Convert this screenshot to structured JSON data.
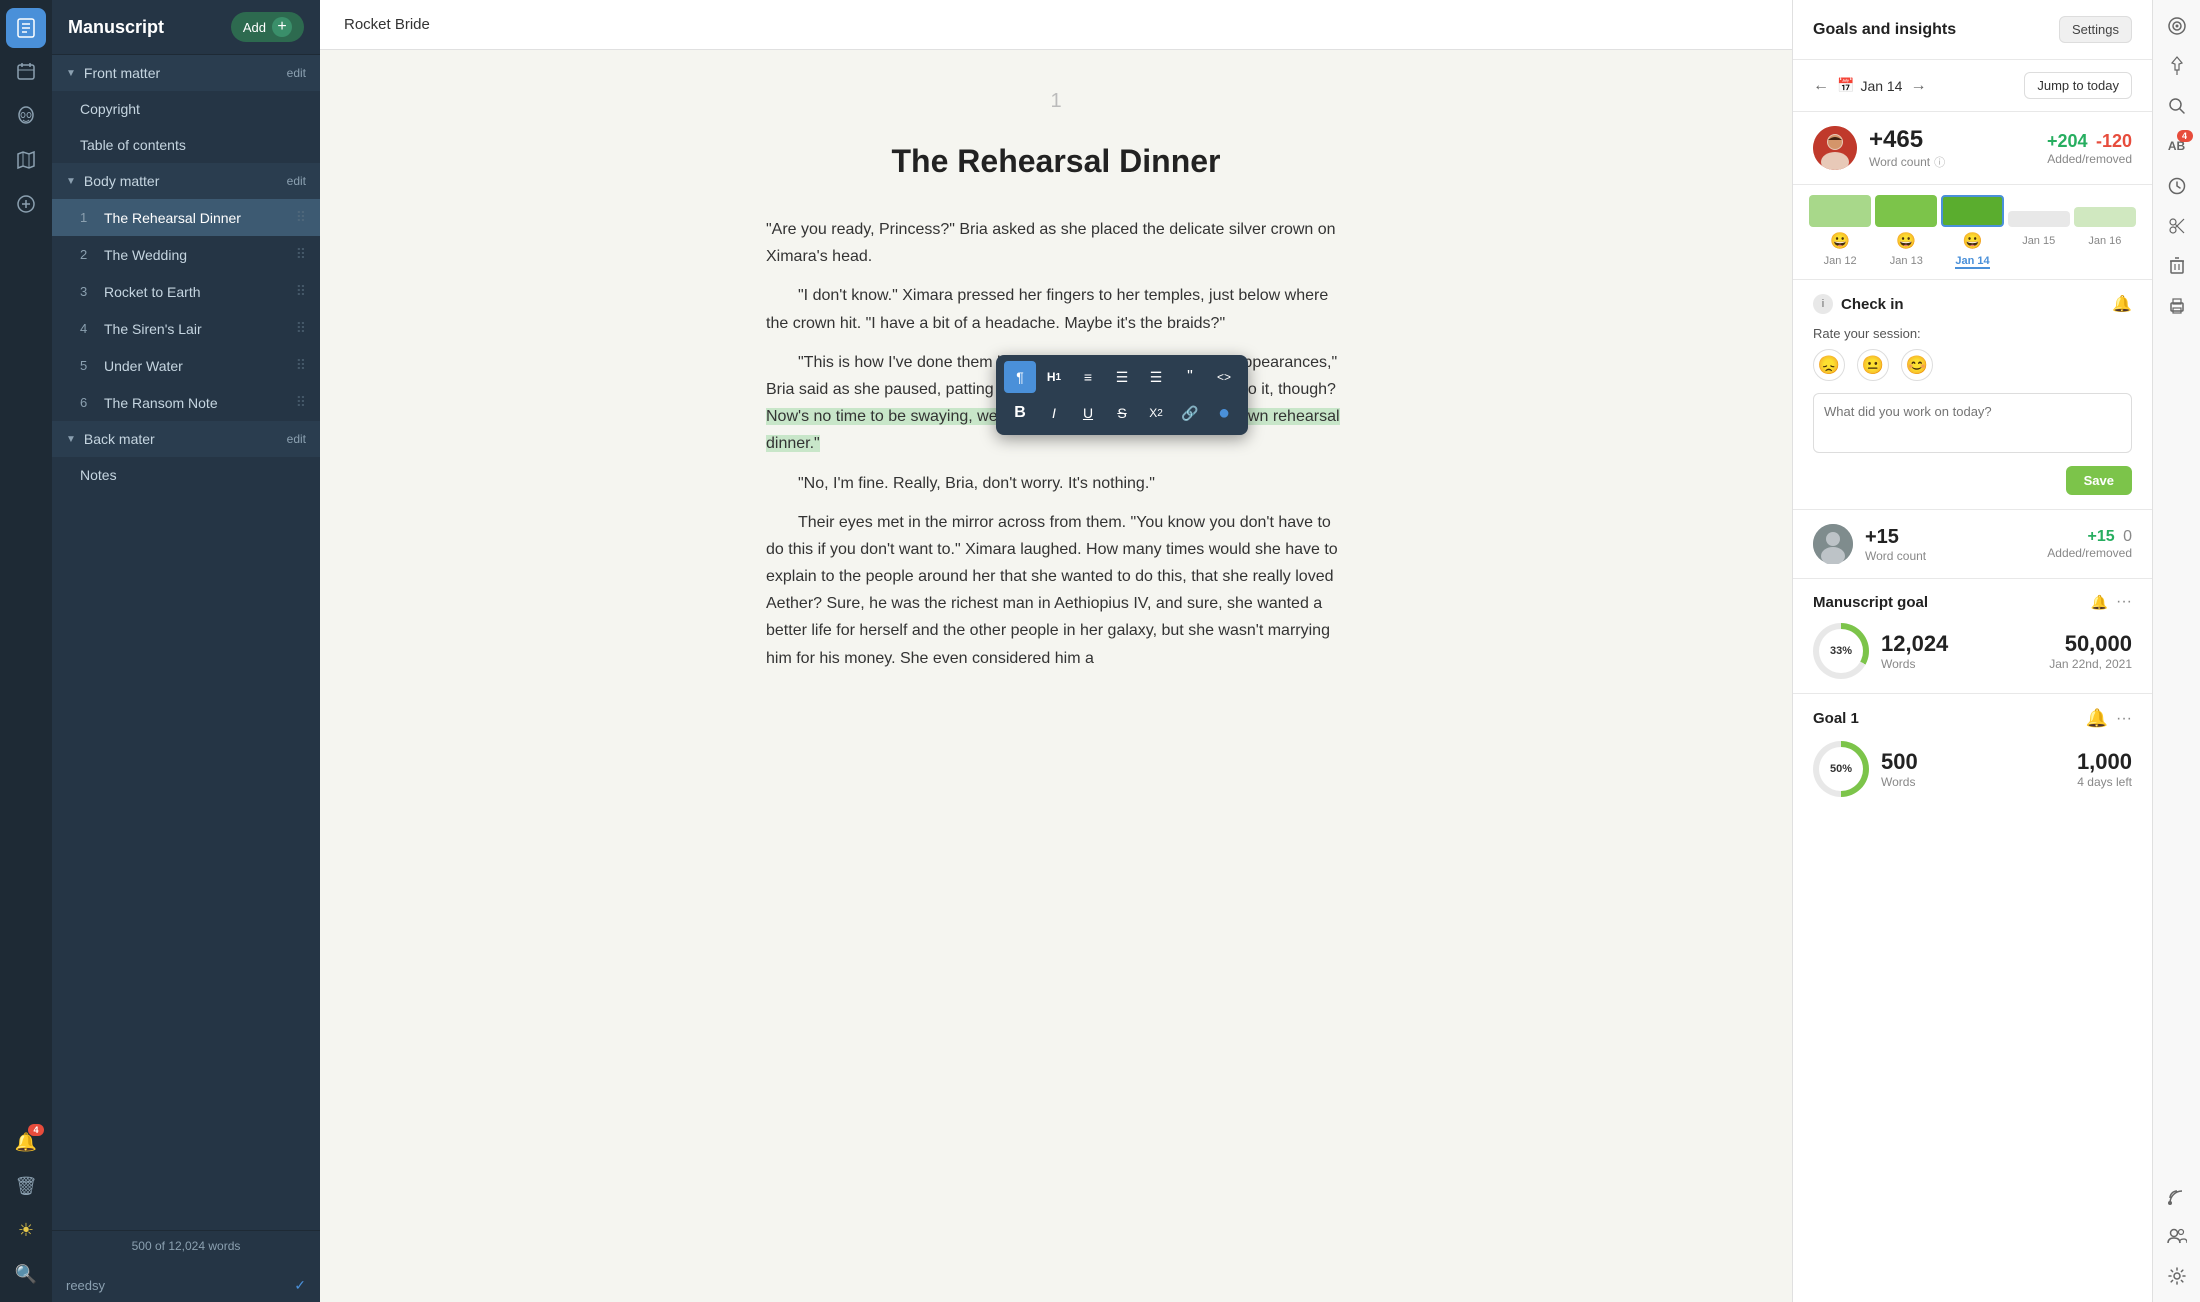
{
  "app": {
    "title": "Manuscript",
    "add_label": "Add",
    "book_title": "Rocket Bride"
  },
  "sidebar": {
    "front_matter": {
      "label": "Front matter",
      "edit": "edit",
      "items": [
        {
          "id": "copyright",
          "label": "Copyright",
          "num": ""
        },
        {
          "id": "toc",
          "label": "Table of contents",
          "num": ""
        }
      ]
    },
    "body_matter": {
      "label": "Body matter",
      "edit": "edit",
      "items": [
        {
          "id": "ch1",
          "num": "1",
          "label": "The Rehearsal Dinner"
        },
        {
          "id": "ch2",
          "num": "2",
          "label": "The Wedding"
        },
        {
          "id": "ch3",
          "num": "3",
          "label": "Rocket to Earth"
        },
        {
          "id": "ch4",
          "num": "4",
          "label": "The Siren's Lair"
        },
        {
          "id": "ch5",
          "num": "5",
          "label": "Under Water"
        },
        {
          "id": "ch6",
          "num": "6",
          "label": "The Ransom Note"
        }
      ]
    },
    "back_matter": {
      "label": "Back mater",
      "edit": "edit",
      "items": [
        {
          "id": "notes",
          "label": "Notes",
          "num": ""
        }
      ]
    },
    "word_count": "500 of 12,024 words",
    "branding": "reedsy"
  },
  "editor": {
    "chapter_num": "1",
    "chapter_title": "The Rehearsal Dinner",
    "content": [
      {
        "type": "quote",
        "text": "“Are you ready, Princess?” Bria asked as she placed the delicate silver crown on Ximara’s head."
      },
      {
        "type": "indent",
        "text": "“I don’t know.” Ximara pressed her fingers to her temples, just below where the crown hit. “I have a bit of a headache. Maybe it’s the braids?”"
      },
      {
        "type": "indent",
        "text": "“This is how I’ve done them been for every one of your public appearances,” Bria said as she paused, patting Ximara on the shoulder. “You can do it, though? Now’s no time to be swaying, we wouldn’t want to pass out at your own rehearsal dinner.”",
        "highlight_start": true
      },
      {
        "type": "indent",
        "text": "“No, I’m fine. Really, Bria, don’t worry. It’s nothing.”"
      },
      {
        "type": "indent",
        "text": "Their eyes met in the mirror across from them. “You know you don’t have to do this if you don’t want to.” Ximara laughed. How many times would she have to explain to the people around her that she wanted to do this, that she really loved Aether? Sure, he was the richest man in Aethiopius IV, and sure, she wanted a better life for herself and the other people in her galaxy, but she wasn’t marrying him for his money. She even considered him a"
      }
    ]
  },
  "toolbar": {
    "buttons": [
      {
        "id": "paragraph",
        "label": "¶",
        "active": true
      },
      {
        "id": "h1",
        "label": "H₁"
      },
      {
        "id": "align",
        "label": "≡"
      },
      {
        "id": "ul",
        "label": "☰"
      },
      {
        "id": "ol",
        "label": "☲"
      },
      {
        "id": "quote",
        "label": "“”"
      },
      {
        "id": "code",
        "label": "<>"
      },
      {
        "id": "bold",
        "label": "B"
      },
      {
        "id": "italic",
        "label": "I"
      },
      {
        "id": "underline",
        "label": "U"
      },
      {
        "id": "strikethrough",
        "label": "S"
      },
      {
        "id": "superscript",
        "label": "X²"
      },
      {
        "id": "link",
        "label": "🔗"
      },
      {
        "id": "ai",
        "label": "●",
        "blue": true
      }
    ]
  },
  "goals": {
    "title": "Goals and insights",
    "settings_label": "Settings",
    "date": "Jan 14",
    "jump_today": "Jump to today",
    "stats": {
      "word_count_label": "Word count",
      "word_count": "+465",
      "added": "+204",
      "removed": "-120",
      "added_removed_label": "Added/removed"
    },
    "calendar": [
      {
        "date": "Jan 12",
        "level": "low",
        "emoji": "😀"
      },
      {
        "date": "Jan 13",
        "level": "mid",
        "emoji": "😀"
      },
      {
        "date": "Jan 14",
        "level": "high",
        "emoji": "😀",
        "active": true
      },
      {
        "date": "Jan 15",
        "level": "empty",
        "emoji": ""
      },
      {
        "date": "Jan 16",
        "level": "partial",
        "emoji": ""
      }
    ],
    "checkin": {
      "title": "Check in",
      "rate_label": "Rate your session:",
      "placeholder": "What did you work on today?",
      "save_label": "Save"
    },
    "user_session": {
      "word_count": "+15",
      "word_count_label": "Word count",
      "added": "+15",
      "removed": "0",
      "added_removed_label": "Added/removed"
    },
    "manuscript_goal": {
      "title": "Manuscript goal",
      "progress_pct": "33%",
      "words": "12,024",
      "words_label": "Words",
      "target": "50,000",
      "target_date": "Jan 22nd, 2021"
    },
    "goal1": {
      "title": "Goal 1",
      "progress_pct": "50%",
      "words": "500",
      "words_label": "Words",
      "target": "1,000",
      "target_label": "4 days left"
    }
  },
  "right_icons": [
    {
      "id": "target",
      "symbol": "◎",
      "badge": ""
    },
    {
      "id": "pin",
      "symbol": "📌",
      "badge": ""
    },
    {
      "id": "search",
      "symbol": "🔍",
      "badge": ""
    },
    {
      "id": "spellcheck",
      "symbol": "AB✓",
      "badge": "4"
    },
    {
      "id": "history",
      "symbol": "⏰",
      "badge": ""
    },
    {
      "id": "scissors",
      "symbol": "✂",
      "badge": ""
    },
    {
      "id": "trash",
      "symbol": "🗑",
      "badge": ""
    },
    {
      "id": "print",
      "symbol": "🖨",
      "badge": ""
    },
    {
      "id": "feed",
      "symbol": "▤",
      "badge": ""
    },
    {
      "id": "users",
      "symbol": "👥",
      "badge": ""
    },
    {
      "id": "settings2",
      "symbol": "⚙",
      "badge": ""
    }
  ]
}
